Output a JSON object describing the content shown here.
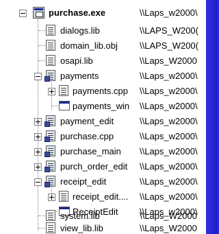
{
  "tree": {
    "root": {
      "name": "purchase.exe",
      "path": "\\\\Laps_w2000\\",
      "expander": "minus"
    },
    "items": [
      {
        "name": "dialogs.lib",
        "path": "\\\\LAPS_W200(",
        "icon": "file-icon"
      },
      {
        "name": "domain_lib.obj",
        "path": "\\\\LAPS_W200(",
        "icon": "file-icon"
      },
      {
        "name": "osapi.lib",
        "path": "\\\\Laps_W2000",
        "icon": "file-icon"
      },
      {
        "name": "payments",
        "path": "\\\\Laps_w2000\\",
        "icon": "file-colored-icon",
        "expander": "minus"
      },
      {
        "name": "payments.cpp",
        "path": "\\\\Laps_w2000\\",
        "icon": "file-icon",
        "expander": "plus"
      },
      {
        "name": "payments_win",
        "path": "\\\\Laps_w2000\\",
        "icon": "window-icon"
      },
      {
        "name": "payment_edit",
        "path": "\\\\Laps_w2000\\",
        "icon": "file-colored-icon",
        "expander": "plus"
      },
      {
        "name": "purchase.cpp",
        "path": "\\\\Laps_w2000\\",
        "icon": "file-colored-icon",
        "expander": "plus"
      },
      {
        "name": "purchase_main",
        "path": "\\\\Laps_w2000\\",
        "icon": "file-colored-icon",
        "expander": "plus"
      },
      {
        "name": "purch_order_edit",
        "path": "\\\\Laps_w2000\\",
        "icon": "file-colored-icon",
        "expander": "plus"
      },
      {
        "name": "receipt_edit",
        "path": "\\\\Laps_w2000\\",
        "icon": "file-colored-icon",
        "expander": "minus"
      },
      {
        "name": "receipt_edit....",
        "path": "\\\\Laps_w2000\\",
        "icon": "file-icon",
        "expander": "plus"
      },
      {
        "name": "ReceiptEdit",
        "path": "\\\\Laps_w2000\\",
        "icon": "window-icon"
      },
      {
        "name": "system.lib",
        "path": "\\\\Laps_W2000",
        "icon": "file-icon"
      },
      {
        "name": "view_lib.lib",
        "path": "\\\\Laps_W2000",
        "icon": "file-icon"
      }
    ]
  }
}
